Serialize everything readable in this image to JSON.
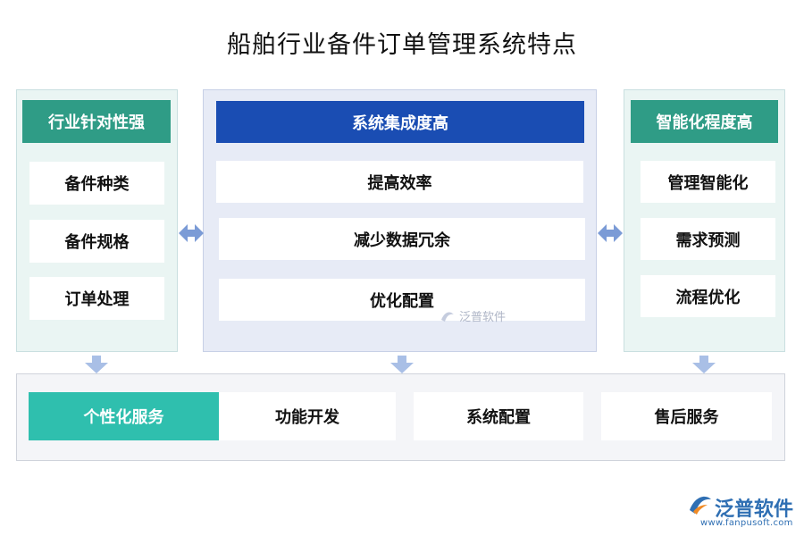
{
  "title": "船舶行业备件订单管理系统特点",
  "left": {
    "header": "行业针对性强",
    "items": [
      "备件种类",
      "备件规格",
      "订单处理"
    ]
  },
  "middle": {
    "header": "系统集成度高",
    "items": [
      "提高效率",
      "减少数据冗余",
      "优化配置"
    ]
  },
  "right": {
    "header": "智能化程度高",
    "items": [
      "管理智能化",
      "需求预测",
      "流程优化"
    ]
  },
  "bottom": {
    "items": [
      "个性化服务",
      "功能开发",
      "系统配置",
      "售后服务"
    ]
  },
  "watermark": "泛普软件",
  "logo": {
    "name": "泛普软件",
    "url": "www.fanpusoft.com"
  },
  "colors": {
    "teal_header": "#2f9c86",
    "blue_header": "#1a4db3",
    "active_bottom": "#2fbfae",
    "arrow": "#7b9bd6"
  }
}
